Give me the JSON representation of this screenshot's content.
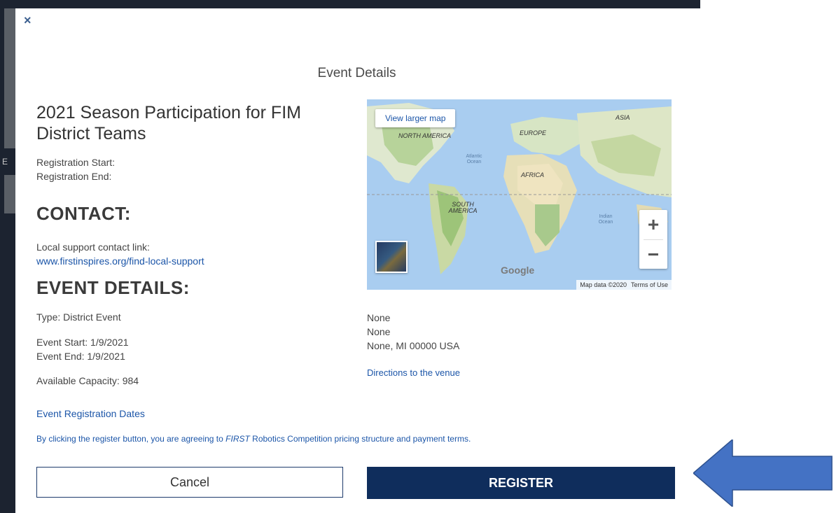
{
  "modal": {
    "close_label": "×",
    "title": "Event Details",
    "event_name": "2021 Season Participation for FIM District Teams",
    "registration_start": "Registration Start:",
    "registration_end": "Registration End:",
    "contact_heading": "CONTACT:",
    "contact_label": "Local support contact link:",
    "contact_link": "www.firstinspires.org/find-local-support",
    "details_heading": "EVENT DETAILS:",
    "type": "Type: District Event",
    "event_start": "Event Start: 1/9/2021",
    "event_end": "Event End: 1/9/2021",
    "capacity": "Available Capacity: 984",
    "registration_dates_link": "Event Registration Dates",
    "venue": {
      "line1": "None",
      "line2": "None",
      "line3": "None, MI 00000 USA",
      "directions_link": "Directions to the venue"
    },
    "agreement_prefix": "By clicking the register button, you are agreeing to ",
    "agreement_emphasis": "FIRST",
    "agreement_suffix": " Robotics Competition pricing structure and payment terms.",
    "cancel_label": "Cancel",
    "register_label": "REGISTER"
  },
  "map": {
    "view_larger": "View larger map",
    "zoom_in": "+",
    "zoom_out": "−",
    "logo": "Google",
    "attribution": "Map data ©2020",
    "terms": "Terms of Use",
    "labels": {
      "north_america": "NORTH AMERICA",
      "south_america": "SOUTH AMERICA",
      "europe": "EUROPE",
      "africa": "AFRICA",
      "asia": "ASIA",
      "atlantic": "Atlantic Ocean",
      "indian": "Indian Ocean"
    }
  },
  "backdrop": {
    "ghost_text": "E"
  },
  "colors": {
    "accent": "#0f2d5c",
    "link": "#1b55a8",
    "arrow": "#4472c4"
  }
}
